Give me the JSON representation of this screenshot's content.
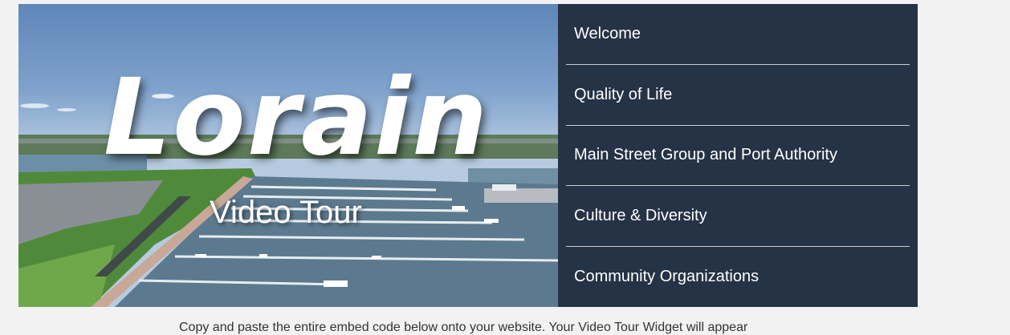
{
  "hero": {
    "title": "Lorain",
    "subtitle": "Video Tour"
  },
  "menu": {
    "items": [
      {
        "label": "Welcome"
      },
      {
        "label": "Quality of Life"
      },
      {
        "label": "Main Street Group and Port Authority"
      },
      {
        "label": "Culture & Diversity"
      },
      {
        "label": "Community Organizations"
      }
    ]
  },
  "footer": {
    "text": "Copy and paste the entire embed code below onto your website. Your Video Tour Widget will appear"
  },
  "colors": {
    "menu_background": "#263245",
    "page_background": "#f2f2f2",
    "water": "#5c7a8f",
    "land": "#4f8a3a"
  }
}
